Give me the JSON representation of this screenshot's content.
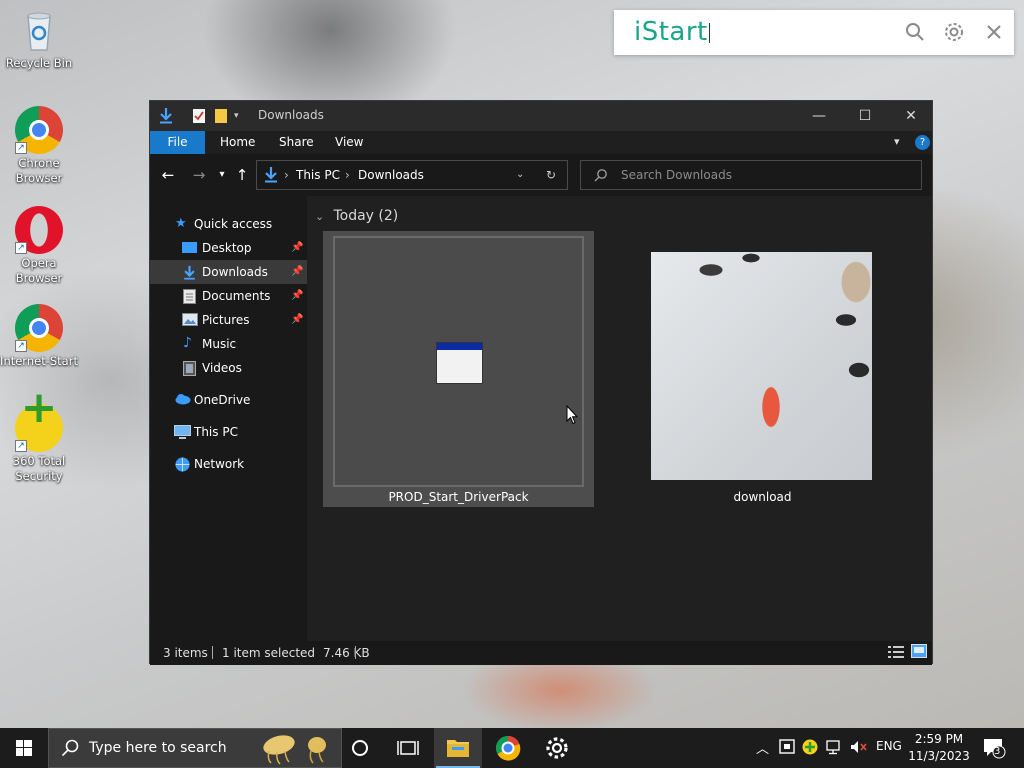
{
  "desktop": {
    "icons": [
      {
        "label": "Recycle Bin",
        "icon": "recycle-bin-icon"
      },
      {
        "label": "Chrone Browser",
        "icon": "chrome-icon"
      },
      {
        "label": "Opera Browser",
        "icon": "opera-icon"
      },
      {
        "label": "Internet-Start",
        "icon": "chrome-icon"
      },
      {
        "label": "360 Total Security",
        "icon": "360-total-security-icon"
      }
    ]
  },
  "istart": {
    "logo": "iStart",
    "search_value": "",
    "icons": [
      "search-icon",
      "gear-icon",
      "close-icon"
    ]
  },
  "explorer": {
    "title": "Downloads",
    "ribbon_tabs": [
      "File",
      "Home",
      "Share",
      "View"
    ],
    "breadcrumb": [
      "This PC",
      "Downloads"
    ],
    "search_placeholder": "Search Downloads",
    "nav": [
      {
        "label": "Quick access",
        "icon": "star-icon"
      },
      {
        "label": "Desktop",
        "icon": "desktop-folder-icon",
        "pinned": true
      },
      {
        "label": "Downloads",
        "icon": "download-arrow-icon",
        "pinned": true,
        "selected": true
      },
      {
        "label": "Documents",
        "icon": "documents-icon",
        "pinned": true
      },
      {
        "label": "Pictures",
        "icon": "pictures-icon",
        "pinned": true
      },
      {
        "label": "Music",
        "icon": "music-icon"
      },
      {
        "label": "Videos",
        "icon": "videos-icon"
      },
      {
        "label": "OneDrive",
        "icon": "cloud-icon"
      },
      {
        "label": "This PC",
        "icon": "computer-icon"
      },
      {
        "label": "Network",
        "icon": "network-icon"
      }
    ],
    "group_header": "Today (2)",
    "files": [
      {
        "name": "PROD_Start_DriverPack",
        "icon": "application-window-icon",
        "selected": true
      },
      {
        "name": "download",
        "icon": "photo-thumbnail"
      }
    ],
    "status": {
      "items": "3 items",
      "selection": "1 item selected",
      "size": "7.46 KB"
    }
  },
  "taskbar": {
    "search_placeholder": "Type here to search",
    "language": "ENG",
    "time": "2:59 PM",
    "date": "11/3/2023",
    "notification_count": "3",
    "accent": "#76b9ed"
  }
}
